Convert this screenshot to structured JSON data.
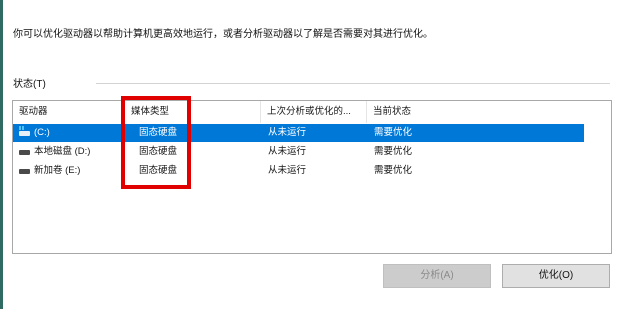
{
  "dialog": {
    "description": "你可以优化驱动器以帮助计算机更高效地运行，或者分析驱动器以了解是否需要对其进行优化。",
    "status_label": "状态(T)"
  },
  "table": {
    "columns": [
      "驱动器",
      "媒体类型",
      "上次分析或优化的...",
      "当前状态"
    ],
    "rows": [
      {
        "drive": "(C:)",
        "media": "固态硬盘",
        "last_run": "从未运行",
        "status": "需要优化",
        "selected": true,
        "icon": "windows-drive-icon"
      },
      {
        "drive": "本地磁盘 (D:)",
        "media": "固态硬盘",
        "last_run": "从未运行",
        "status": "需要优化",
        "selected": false,
        "icon": "drive-icon"
      },
      {
        "drive": "新加卷 (E:)",
        "media": "固态硬盘",
        "last_run": "从未运行",
        "status": "需要优化",
        "selected": false,
        "icon": "drive-icon"
      }
    ]
  },
  "buttons": {
    "analyze": "分析(A)",
    "optimize": "优化(O)"
  },
  "colors": {
    "selection": "#0078d7",
    "highlight": "#e00000"
  }
}
